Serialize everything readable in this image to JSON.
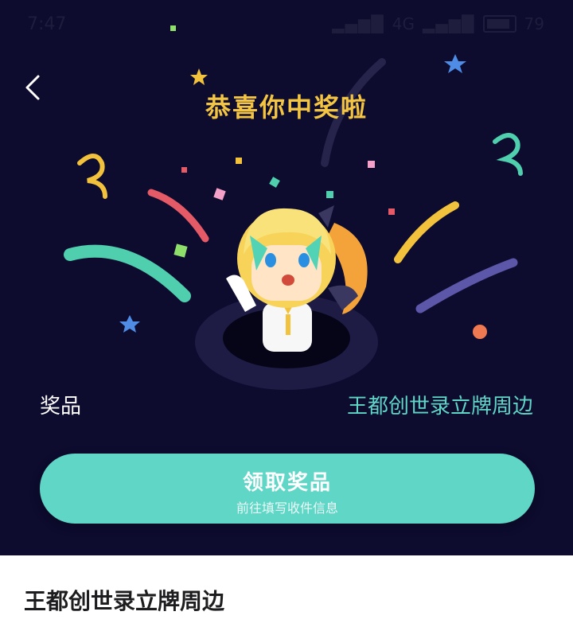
{
  "status_bar": {
    "time": "7:47",
    "network": "4G",
    "battery": "79"
  },
  "header": {
    "title": "恭喜你中奖啦"
  },
  "prize": {
    "label": "奖品",
    "value": "王都创世录立牌周边"
  },
  "claim_button": {
    "label": "领取奖品",
    "sublabel": "前往填写收件信息"
  },
  "detail": {
    "title": "王都创世录立牌周边"
  },
  "colors": {
    "background": "#0d0b2e",
    "title": "#f4c542",
    "accent": "#5fd6c6",
    "text": "#ffffff"
  },
  "icons": {
    "back": "chevron-left-icon"
  }
}
